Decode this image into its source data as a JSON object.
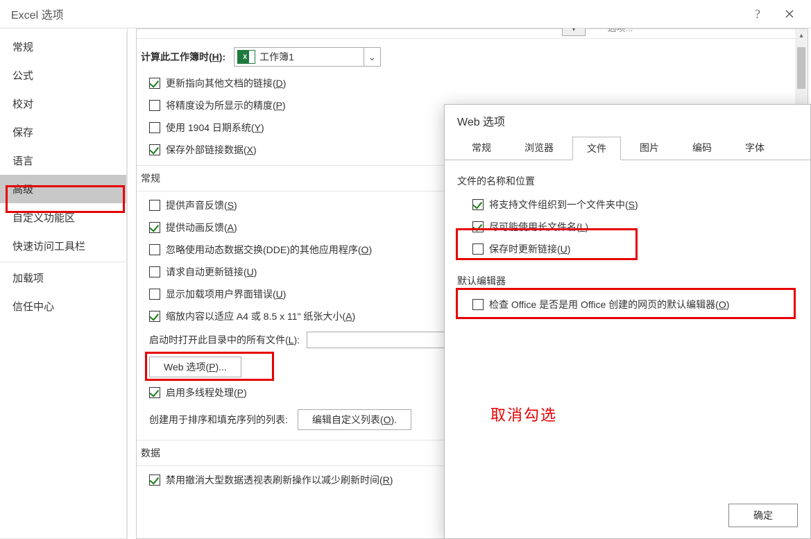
{
  "main": {
    "title": "Excel 选项",
    "sidebar": {
      "items": [
        {
          "label": "常规"
        },
        {
          "label": "公式"
        },
        {
          "label": "校对"
        },
        {
          "label": "保存"
        },
        {
          "label": "语言"
        },
        {
          "label": "高级",
          "selected": true
        },
        {
          "label": "自定义功能区"
        },
        {
          "label": "快速访问工具栏"
        },
        {
          "label": "加载项"
        },
        {
          "label": "信任中心"
        }
      ]
    },
    "cutoff_button": "选项...",
    "workbook": {
      "label_prefix": "计算此工作簿时(",
      "label_key": "H",
      "label_suffix": "):",
      "name": "工作簿1"
    },
    "calc_opts": [
      {
        "checked": true,
        "text": "更新指向其他文档的链接(",
        "key": "D",
        "suffix": ")"
      },
      {
        "checked": false,
        "text": "将精度设为所显示的精度(",
        "key": "P",
        "suffix": ")"
      },
      {
        "checked": false,
        "text": "使用 1904 日期系统(",
        "key": "Y",
        "suffix": ")"
      },
      {
        "checked": true,
        "text": "保存外部链接数据(",
        "key": "X",
        "suffix": ")"
      }
    ],
    "general": {
      "header": "常规",
      "items": [
        {
          "checked": false,
          "text": "提供声音反馈(",
          "key": "S",
          "suffix": ")"
        },
        {
          "checked": true,
          "text": "提供动画反馈(",
          "key": "A",
          "suffix": ")"
        },
        {
          "checked": false,
          "text": "忽略使用动态数据交换(DDE)的其他应用程序(",
          "key": "O",
          "suffix": ")"
        },
        {
          "checked": false,
          "text": "请求自动更新链接(",
          "key": "U",
          "suffix": ")"
        },
        {
          "checked": false,
          "text": "显示加载项用户界面错误(",
          "key": "U",
          "suffix": ")"
        },
        {
          "checked": true,
          "text": "缩放内容以适应 A4 或 8.5 x 11\" 纸张大小(",
          "key": "A",
          "suffix": ")"
        }
      ],
      "startup_label": "启动时打开此目录中的所有文件(",
      "startup_key": "L",
      "startup_suffix": "):",
      "web_btn": "Web 选项(",
      "web_btn_key": "P",
      "web_btn_suffix": ")...",
      "multithread": {
        "checked": true,
        "text": "启用多线程处理(",
        "key": "P",
        "suffix": ")"
      },
      "sort_label": "创建用于排序和填充序列的列表:",
      "sort_btn": "编辑自定义列表(",
      "sort_btn_key": "O",
      "sort_btn_suffix": ")."
    },
    "data": {
      "header": "数据",
      "item": {
        "checked": true,
        "text": "禁用撤消大型数据透视表刷新操作以减少刷新时间(",
        "key": "R",
        "suffix": ")"
      }
    }
  },
  "web": {
    "title": "Web 选项",
    "tabs": [
      "常规",
      "浏览器",
      "文件",
      "图片",
      "编码",
      "字体"
    ],
    "active_tab": 2,
    "group1": "文件的名称和位置",
    "file_opts": [
      {
        "checked": true,
        "text": "将支持文件组织到一个文件夹中(",
        "key": "S",
        "suffix": ")"
      },
      {
        "checked": true,
        "text": "尽可能使用长文件名(",
        "key": "L",
        "suffix": ")"
      },
      {
        "checked": false,
        "text": "保存时更新链接(",
        "key": "U",
        "suffix": ")"
      }
    ],
    "group2": "默认编辑器",
    "editor_opt": {
      "checked": false,
      "text": "检查 Office 是否是用 Office 创建的网页的默认编辑器(",
      "key": "O",
      "suffix": ")"
    },
    "annotation": "取消勾选",
    "ok": "确定"
  }
}
